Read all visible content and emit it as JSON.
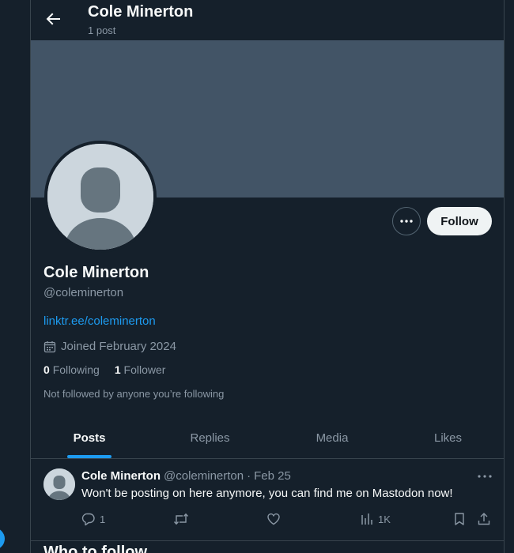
{
  "header": {
    "name": "Cole Minerton",
    "post_count": "1 post"
  },
  "profile": {
    "name": "Cole Minerton",
    "handle": "@coleminerton",
    "link": "linktr.ee/coleminerton",
    "joined": "Joined February 2024",
    "following_count": "0",
    "following_label": "Following",
    "followers_count": "1",
    "followers_label": "Follower",
    "not_followed": "Not followed by anyone you’re following"
  },
  "actions": {
    "follow_label": "Follow"
  },
  "tabs": [
    {
      "label": "Posts",
      "active": true
    },
    {
      "label": "Replies",
      "active": false
    },
    {
      "label": "Media",
      "active": false
    },
    {
      "label": "Likes",
      "active": false
    }
  ],
  "post": {
    "name": "Cole Minerton",
    "handle": "@coleminerton",
    "separator": "·",
    "date": "Feb 25",
    "text": "Won't be posting on here anymore, you can find me on Mastodon now!",
    "replies": "1",
    "views": "1K"
  },
  "next_section": {
    "heading": "Who to follow"
  },
  "colors": {
    "background": "#15202b",
    "banner": "#425466",
    "accent": "#1d9bf0",
    "muted": "#8b98a5",
    "border": "#38444d"
  }
}
